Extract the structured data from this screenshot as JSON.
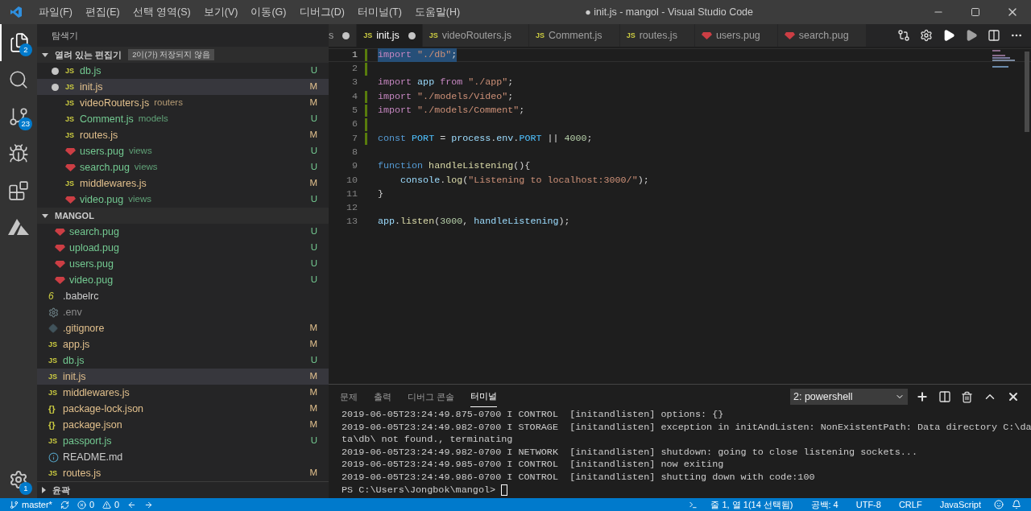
{
  "menu": [
    "파일(F)",
    "편집(E)",
    "선택 영역(S)",
    "보기(V)",
    "이동(G)",
    "디버그(D)",
    "터미널(T)",
    "도움말(H)"
  ],
  "window": {
    "title": "● init.js - mangol - Visual Studio Code"
  },
  "activity_bar": [
    {
      "kind": "explorer",
      "badge": "2",
      "selected": true
    },
    {
      "kind": "search",
      "selected": false
    },
    {
      "kind": "scm",
      "badge": "23",
      "selected": false
    },
    {
      "kind": "debug",
      "selected": false
    },
    {
      "kind": "extensions",
      "selected": false
    },
    {
      "kind": "azure",
      "selected": false
    }
  ],
  "settings_badge": "1",
  "sidebar": {
    "title": "탐색기",
    "open_editors": {
      "title": "열려 있는 편집기",
      "badge": "2이(가) 저장되지 않음",
      "expanded": true,
      "items": [
        {
          "name": "db.js",
          "kind": "js",
          "glyph": "JS",
          "color": "#73c991",
          "status": "U",
          "dirty": true,
          "selected": false
        },
        {
          "name": "init.js",
          "kind": "js",
          "glyph": "JS",
          "color": "#e2c08d",
          "status": "M",
          "dirty": true,
          "selected": true
        },
        {
          "name": "videoRouters.js",
          "description": "routers",
          "kind": "js",
          "glyph": "JS",
          "color": "#e2c08d",
          "status": "M",
          "dirty": false,
          "selected": false
        },
        {
          "name": "Comment.js",
          "description": "models",
          "kind": "js",
          "glyph": "JS",
          "color": "#73c991",
          "status": "U",
          "dirty": false,
          "selected": false
        },
        {
          "name": "routes.js",
          "kind": "js",
          "glyph": "JS",
          "color": "#e2c08d",
          "status": "M",
          "dirty": false,
          "selected": false
        },
        {
          "name": "users.pug",
          "description": "views",
          "kind": "pug",
          "color": "#73c991",
          "status": "U",
          "dirty": false,
          "selected": false
        },
        {
          "name": "search.pug",
          "description": "views",
          "kind": "pug",
          "color": "#73c991",
          "status": "U",
          "dirty": false,
          "selected": false
        },
        {
          "name": "middlewares.js",
          "kind": "js",
          "glyph": "JS",
          "color": "#e2c08d",
          "status": "M",
          "dirty": false,
          "selected": false
        },
        {
          "name": "video.pug",
          "description": "views",
          "kind": "pug",
          "color": "#73c991",
          "status": "U",
          "dirty": false,
          "selected": false
        }
      ]
    },
    "folder": {
      "title": "MANGOL",
      "expanded": true,
      "items": [
        {
          "name": "search.pug",
          "kind": "pug",
          "color": "#73c991",
          "status": "U",
          "nested": true,
          "selected": false
        },
        {
          "name": "upload.pug",
          "kind": "pug",
          "color": "#73c991",
          "status": "U",
          "nested": true,
          "selected": false
        },
        {
          "name": "users.pug",
          "kind": "pug",
          "color": "#73c991",
          "status": "U",
          "nested": true,
          "selected": false
        },
        {
          "name": "video.pug",
          "kind": "pug",
          "color": "#73c991",
          "status": "U",
          "nested": true,
          "selected": false
        },
        {
          "name": ".babelrc",
          "kind": "babel",
          "glyph": "6",
          "color": "#cccccc",
          "nested": false,
          "selected": false
        },
        {
          "name": ".env",
          "kind": "env",
          "color": "#8c8c8c",
          "nested": false,
          "selected": false
        },
        {
          "name": ".gitignore",
          "kind": "git",
          "color": "#e2c08d",
          "status": "M",
          "nested": false,
          "selected": false
        },
        {
          "name": "app.js",
          "kind": "js",
          "glyph": "JS",
          "color": "#e2c08d",
          "status": "M",
          "nested": false,
          "selected": false
        },
        {
          "name": "db.js",
          "kind": "js",
          "glyph": "JS",
          "color": "#73c991",
          "status": "U",
          "nested": false,
          "selected": false
        },
        {
          "name": "init.js",
          "kind": "js",
          "glyph": "JS",
          "color": "#e2c08d",
          "status": "M",
          "nested": false,
          "selected": true
        },
        {
          "name": "middlewares.js",
          "kind": "js",
          "glyph": "JS",
          "color": "#e2c08d",
          "status": "M",
          "nested": false,
          "selected": false
        },
        {
          "name": "package-lock.json",
          "kind": "json",
          "glyph": "{}",
          "color": "#e2c08d",
          "status": "M",
          "nested": false,
          "selected": false
        },
        {
          "name": "package.json",
          "kind": "json",
          "glyph": "{}",
          "color": "#e2c08d",
          "status": "M",
          "nested": false,
          "selected": false
        },
        {
          "name": "passport.js",
          "kind": "js",
          "glyph": "JS",
          "color": "#73c991",
          "status": "U",
          "nested": false,
          "selected": false
        },
        {
          "name": "README.md",
          "kind": "info",
          "color": "#cccccc",
          "nested": false,
          "selected": false
        },
        {
          "name": "routes.js",
          "kind": "js",
          "glyph": "JS",
          "color": "#e2c08d",
          "status": "M",
          "nested": false,
          "selected": false
        }
      ]
    },
    "outline": {
      "title": "윤곽",
      "expanded": false
    }
  },
  "tabs": [
    {
      "label": "s",
      "kind": "none",
      "dirty": true,
      "selected": false
    },
    {
      "label": "init.js",
      "kind": "js",
      "glyph": "JS",
      "dirty": true,
      "selected": true
    },
    {
      "label": "videoRouters.js",
      "kind": "js",
      "glyph": "JS",
      "dirty": false,
      "selected": false
    },
    {
      "label": "Comment.js",
      "kind": "js",
      "glyph": "JS",
      "dirty": false,
      "selected": false
    },
    {
      "label": "routes.js",
      "kind": "js",
      "glyph": "JS",
      "dirty": false,
      "selected": false
    },
    {
      "label": "users.pug",
      "kind": "pug",
      "dirty": false,
      "selected": false
    },
    {
      "label": "search.pug",
      "kind": "pug",
      "dirty": false,
      "selected": false
    }
  ],
  "editor_actions": [
    {
      "kind": "compare"
    },
    {
      "kind": "settings"
    },
    {
      "kind": "run"
    },
    {
      "kind": "debug-run"
    },
    {
      "kind": "split"
    },
    {
      "kind": "more"
    }
  ],
  "code": [
    {
      "number": "1",
      "gutter": true,
      "selected": true,
      "tokens": [
        {
          "text": "import",
          "kind": "keyword"
        },
        {
          "text": " \"./db\"",
          "kind": "string"
        },
        {
          "text": ";",
          "kind": "plain"
        }
      ]
    },
    {
      "number": "2",
      "gutter": true,
      "selected": false
    },
    {
      "number": "3",
      "gutter": false,
      "selected": false,
      "tokens": [
        {
          "text": "import",
          "kind": "keyword"
        },
        {
          "text": " app ",
          "kind": "variable"
        },
        {
          "text": "from",
          "kind": "keyword"
        },
        {
          "text": " \"./app\"",
          "kind": "string"
        },
        {
          "text": ";",
          "kind": "plain"
        }
      ]
    },
    {
      "number": "4",
      "gutter": true,
      "selected": false,
      "tokens": [
        {
          "text": "import",
          "kind": "keyword"
        },
        {
          "text": " \"./models/Video\"",
          "kind": "string"
        },
        {
          "text": ";",
          "kind": "plain"
        }
      ]
    },
    {
      "number": "5",
      "gutter": true,
      "selected": false,
      "tokens": [
        {
          "text": "import",
          "kind": "keyword"
        },
        {
          "text": " \"./models/Comment\"",
          "kind": "string"
        },
        {
          "text": ";",
          "kind": "plain"
        }
      ]
    },
    {
      "number": "6",
      "gutter": true,
      "selected": false
    },
    {
      "number": "7",
      "gutter": true,
      "selected": false,
      "tokens": [
        {
          "text": "const",
          "kind": "storage"
        },
        {
          "text": " PORT ",
          "kind": "constant"
        },
        {
          "text": "=",
          "kind": "plain"
        },
        {
          "text": " process",
          "kind": "variable"
        },
        {
          "text": ".",
          "kind": "plain"
        },
        {
          "text": "env",
          "kind": "variable"
        },
        {
          "text": ".",
          "kind": "plain"
        },
        {
          "text": "PORT",
          "kind": "constant"
        },
        {
          "text": " || ",
          "kind": "plain"
        },
        {
          "text": "4000",
          "kind": "number"
        },
        {
          "text": ";",
          "kind": "plain"
        }
      ]
    },
    {
      "number": "8",
      "gutter": false,
      "selected": false
    },
    {
      "number": "9",
      "gutter": false,
      "selected": false,
      "tokens": [
        {
          "text": "function",
          "kind": "storage"
        },
        {
          "text": " handleListening",
          "kind": "function"
        },
        {
          "text": "(){",
          "kind": "plain"
        }
      ]
    },
    {
      "number": "10",
      "gutter": false,
      "selected": false,
      "tokens": [
        {
          "text": "    console",
          "kind": "variable"
        },
        {
          "text": ".",
          "kind": "plain"
        },
        {
          "text": "log",
          "kind": "function"
        },
        {
          "text": "(",
          "kind": "plain"
        },
        {
          "text": "\"Listening to localhost:3000/\"",
          "kind": "string"
        },
        {
          "text": ");",
          "kind": "plain"
        }
      ]
    },
    {
      "number": "11",
      "gutter": false,
      "selected": false,
      "tokens": [
        {
          "text": "}",
          "kind": "plain"
        }
      ]
    },
    {
      "number": "12",
      "gutter": false,
      "selected": false
    },
    {
      "number": "13",
      "gutter": false,
      "selected": false,
      "tokens": [
        {
          "text": "app",
          "kind": "variable"
        },
        {
          "text": ".",
          "kind": "plain"
        },
        {
          "text": "listen",
          "kind": "function"
        },
        {
          "text": "(",
          "kind": "plain"
        },
        {
          "text": "3000",
          "kind": "number"
        },
        {
          "text": ", ",
          "kind": "plain"
        },
        {
          "text": "handleListening",
          "kind": "variable"
        },
        {
          "text": ");",
          "kind": "plain"
        }
      ]
    }
  ],
  "panel": {
    "tabs": [
      {
        "label": "문제",
        "selected": false
      },
      {
        "label": "출력",
        "selected": false
      },
      {
        "label": "디버그 콘솔",
        "selected": false
      },
      {
        "label": "터미널",
        "selected": true
      }
    ],
    "terminal_select": "2: powershell",
    "actions": [
      {
        "kind": "add"
      },
      {
        "kind": "split"
      },
      {
        "kind": "trash"
      },
      {
        "kind": "maximize"
      },
      {
        "kind": "close"
      }
    ],
    "lines": [
      "2019-06-05T23:24:49.875-0700 I CONTROL  [initandlisten] options: {}",
      "2019-06-05T23:24:49.982-0700 I STORAGE  [initandlisten] exception in initAndListen: NonExistentPath: Data directory C:\\da",
      "ta\\db\\ not found., terminating",
      "2019-06-05T23:24:49.982-0700 I NETWORK  [initandlisten] shutdown: going to close listening sockets...",
      "2019-06-05T23:24:49.985-0700 I CONTROL  [initandlisten] now exiting",
      "2019-06-05T23:24:49.986-0700 I CONTROL  [initandlisten] shutting down with code:100"
    ],
    "prompt": "PS C:\\Users\\Jongbok\\mangol>"
  },
  "status_bar": {
    "branch": "master*",
    "errors": "0",
    "warnings": "0",
    "right": [
      "줄 1, 열 1(14 선택됨)",
      "공백: 4",
      "UTF-8",
      "CRLF",
      "JavaScript"
    ]
  }
}
